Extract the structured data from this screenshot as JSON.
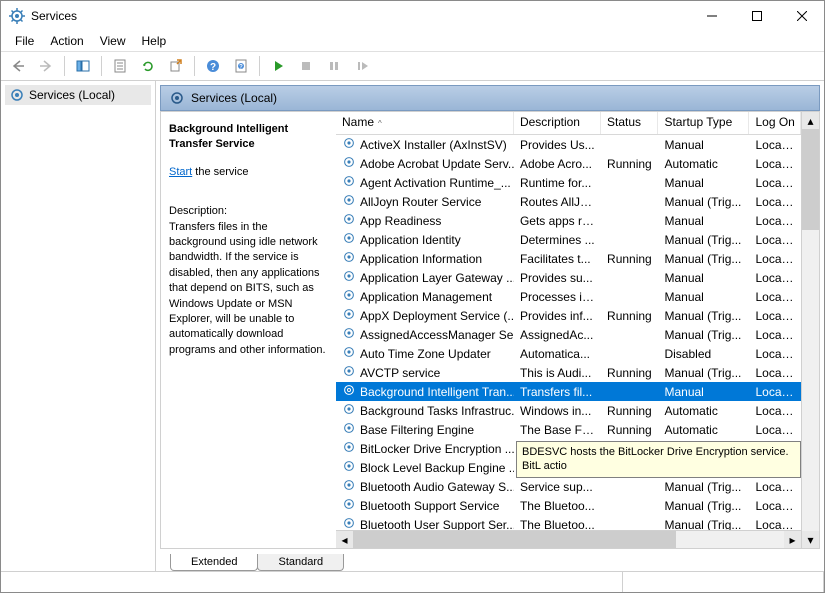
{
  "window": {
    "title": "Services"
  },
  "menu": {
    "file": "File",
    "action": "Action",
    "view": "View",
    "help": "Help"
  },
  "left": {
    "label": "Services (Local)"
  },
  "header": {
    "label": "Services (Local)"
  },
  "detail": {
    "title": "Background Intelligent Transfer Service",
    "start_link": "Start",
    "start_suffix": " the service",
    "desc_label": "Description:",
    "desc_text": "Transfers files in the background using idle network bandwidth. If the service is disabled, then any applications that depend on BITS, such as Windows Update or MSN Explorer, will be unable to automatically download programs and other information."
  },
  "columns": {
    "name": "Name",
    "desc": "Description",
    "status": "Status",
    "startup": "Startup Type",
    "logon": "Log On"
  },
  "tooltip": "BDESVC hosts the BitLocker Drive Encryption service. BitL\nactio",
  "tabs": {
    "extended": "Extended",
    "standard": "Standard"
  },
  "rows": [
    {
      "name": "ActiveX Installer (AxInstSV)",
      "desc": "Provides Us...",
      "status": "",
      "startup": "Manual",
      "logon": "Local Sy"
    },
    {
      "name": "Adobe Acrobat Update Serv...",
      "desc": "Adobe Acro...",
      "status": "Running",
      "startup": "Automatic",
      "logon": "Local Sy"
    },
    {
      "name": "Agent Activation Runtime_...",
      "desc": "Runtime for...",
      "status": "",
      "startup": "Manual",
      "logon": "Local Sy"
    },
    {
      "name": "AllJoyn Router Service",
      "desc": "Routes AllJo...",
      "status": "",
      "startup": "Manual (Trig...",
      "logon": "Local Se"
    },
    {
      "name": "App Readiness",
      "desc": "Gets apps re...",
      "status": "",
      "startup": "Manual",
      "logon": "Local Sy"
    },
    {
      "name": "Application Identity",
      "desc": "Determines ...",
      "status": "",
      "startup": "Manual (Trig...",
      "logon": "Local Se"
    },
    {
      "name": "Application Information",
      "desc": "Facilitates t...",
      "status": "Running",
      "startup": "Manual (Trig...",
      "logon": "Local Sy"
    },
    {
      "name": "Application Layer Gateway ...",
      "desc": "Provides su...",
      "status": "",
      "startup": "Manual",
      "logon": "Local Se"
    },
    {
      "name": "Application Management",
      "desc": "Processes in...",
      "status": "",
      "startup": "Manual",
      "logon": "Local Sy"
    },
    {
      "name": "AppX Deployment Service (...",
      "desc": "Provides inf...",
      "status": "Running",
      "startup": "Manual (Trig...",
      "logon": "Local Sy"
    },
    {
      "name": "AssignedAccessManager Se...",
      "desc": "AssignedAc...",
      "status": "",
      "startup": "Manual (Trig...",
      "logon": "Local Sy"
    },
    {
      "name": "Auto Time Zone Updater",
      "desc": "Automatica...",
      "status": "",
      "startup": "Disabled",
      "logon": "Local Se"
    },
    {
      "name": "AVCTP service",
      "desc": "This is Audi...",
      "status": "Running",
      "startup": "Manual (Trig...",
      "logon": "Local Se"
    },
    {
      "name": "Background Intelligent Tran...",
      "desc": "Transfers fil...",
      "status": "",
      "startup": "Manual",
      "logon": "Local Sy",
      "selected": true
    },
    {
      "name": "Background Tasks Infrastruc...",
      "desc": "Windows in...",
      "status": "Running",
      "startup": "Automatic",
      "logon": "Local Sy"
    },
    {
      "name": "Base Filtering Engine",
      "desc": "The Base Fil...",
      "status": "Running",
      "startup": "Automatic",
      "logon": "Local Se"
    },
    {
      "name": "BitLocker Drive Encryption ...",
      "desc": "",
      "status": "",
      "startup": "",
      "logon": ""
    },
    {
      "name": "Block Level Backup Engine ...",
      "desc": "",
      "status": "",
      "startup": "",
      "logon": ""
    },
    {
      "name": "Bluetooth Audio Gateway S...",
      "desc": "Service sup...",
      "status": "",
      "startup": "Manual (Trig...",
      "logon": "Local Se"
    },
    {
      "name": "Bluetooth Support Service",
      "desc": "The Bluetoo...",
      "status": "",
      "startup": "Manual (Trig...",
      "logon": "Local Se"
    },
    {
      "name": "Bluetooth User Support Ser...",
      "desc": "The Bluetoo...",
      "status": "",
      "startup": "Manual (Trig...",
      "logon": "Local Sy"
    }
  ]
}
